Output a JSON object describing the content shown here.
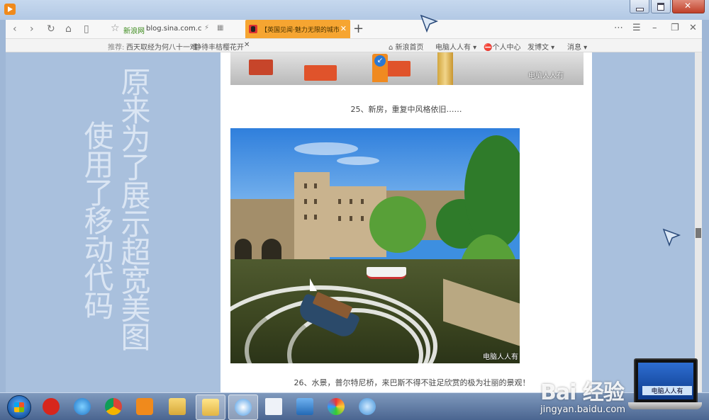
{
  "browser": {
    "site_label": "新浪网",
    "url": "blog.sina.com.c",
    "tab_title": "【英国见闻·魅力无限的城市",
    "new_tab": "+"
  },
  "sitebar": {
    "recommend_label": "推荐:",
    "link1": "西天取经为何八十一难",
    "link2": "静待丰桔樱花开",
    "home": "新浪首页",
    "user": "电脑人人有",
    "center": "个人中心",
    "post": "发博文",
    "messages": "消息"
  },
  "page": {
    "vertical_text_1": "原来为了展示超宽美图",
    "vertical_text_2": "使用了移动代码",
    "caption_25": "25、新房，重复中风格依旧……",
    "caption_26": "26、水景，普尔特尼桥，来巴斯不得不驻足欣赏的极为壮丽的景观！",
    "watermark": "电脑人人有"
  },
  "watermark": {
    "baidu": "Bai  经验",
    "url": "jingyan.baidu.com",
    "laptop_label": "电脑人人有"
  },
  "colors": {
    "tab_active": "#f6a531",
    "page_bg": "#a9c0dd"
  }
}
